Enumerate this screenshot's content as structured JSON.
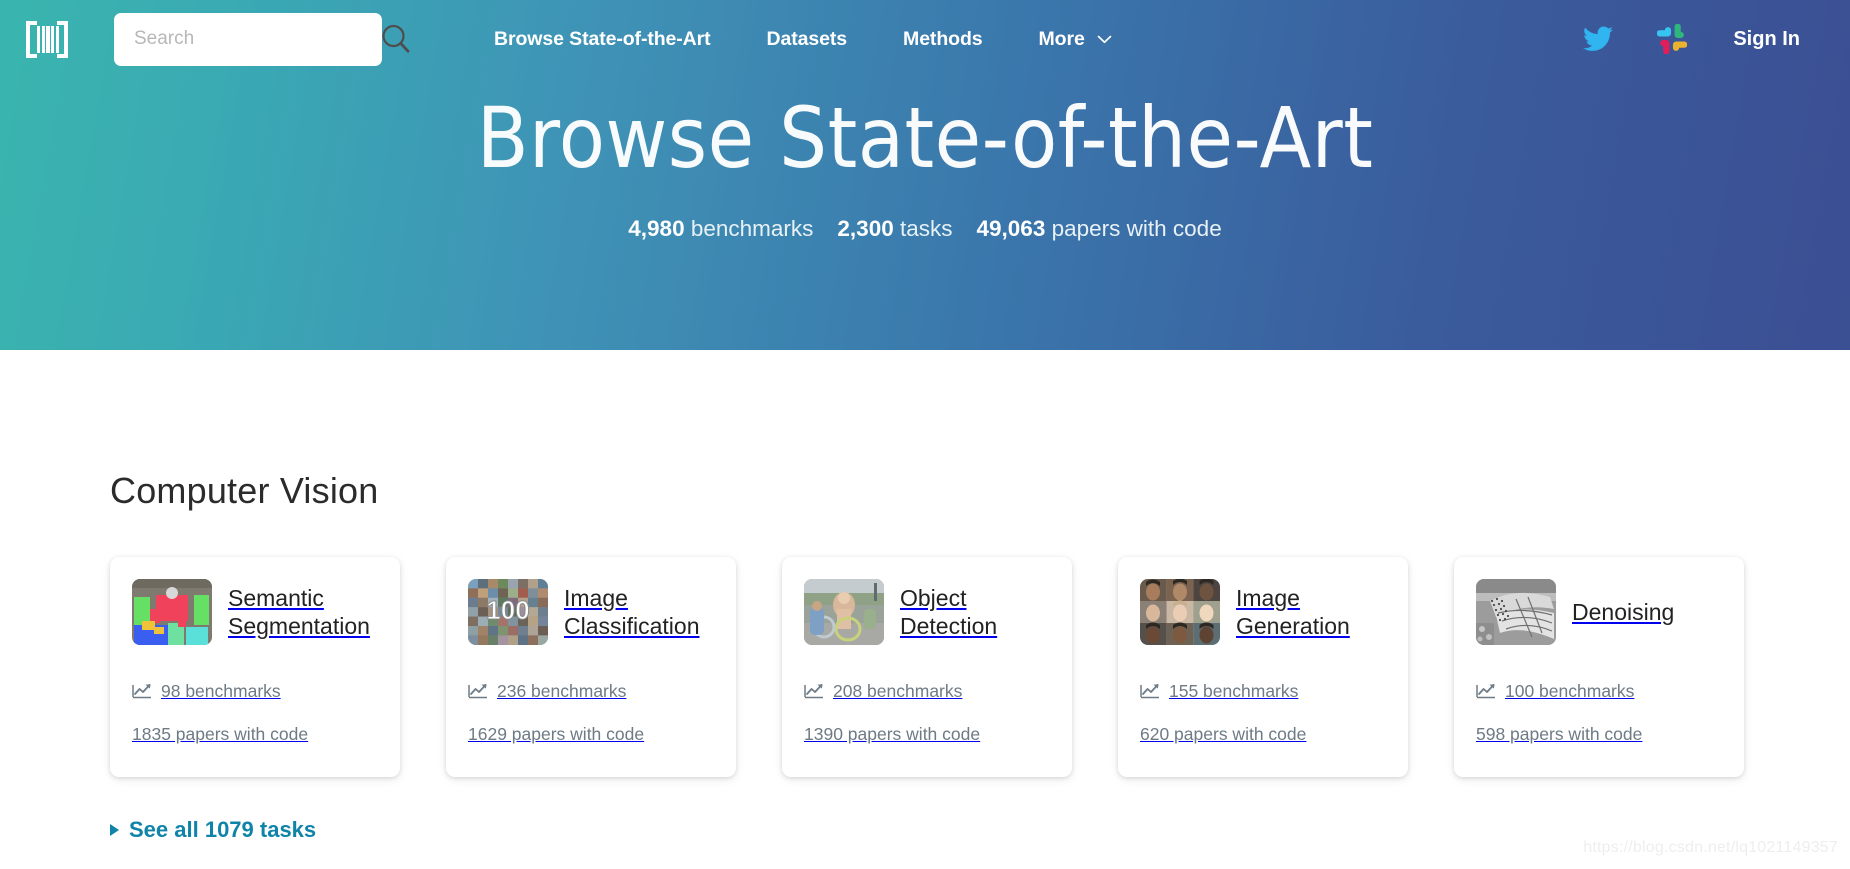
{
  "header": {
    "logo_alt": "Papers With Code",
    "search": {
      "value": "",
      "placeholder": "Search"
    },
    "nav": [
      {
        "label": "Browse State-of-the-Art",
        "has_caret": false
      },
      {
        "label": "Datasets",
        "has_caret": false
      },
      {
        "label": "Methods",
        "has_caret": false
      },
      {
        "label": "More",
        "has_caret": true
      }
    ],
    "twitter_icon": "twitter-icon",
    "slack_icon": "slack-icon",
    "sign_in_label": "Sign In",
    "gradient_from": "#3ab5ae",
    "gradient_to": "#3b4f93"
  },
  "hero": {
    "title": "Browse State-of-the-Art",
    "stats": [
      {
        "number": "4,980",
        "label": "benchmarks"
      },
      {
        "number": "2,300",
        "label": "tasks"
      },
      {
        "number": "49,063",
        "label": "papers with code"
      }
    ]
  },
  "main": {
    "section_title": "Computer Vision",
    "cards": [
      {
        "title": "Semantic Segmentation",
        "thumb": "semantic-segmentation-thumb",
        "benchmarks": "98 benchmarks",
        "papers": "1835 papers with code"
      },
      {
        "title": "Image Classification",
        "thumb": "image-classification-thumb",
        "benchmarks": "236 benchmarks",
        "papers": "1629 papers with code"
      },
      {
        "title": "Object Detection",
        "thumb": "object-detection-thumb",
        "benchmarks": "208 benchmarks",
        "papers": "1390 papers with code"
      },
      {
        "title": "Image Generation",
        "thumb": "image-generation-thumb",
        "benchmarks": "155 benchmarks",
        "papers": "620 papers with code"
      },
      {
        "title": "Denoising",
        "thumb": "denoising-thumb",
        "benchmarks": "100 benchmarks",
        "papers": "598 papers with code"
      }
    ],
    "see_all_label": "See all 1079 tasks",
    "link_color": "#0f83a8"
  },
  "watermark": "https://blog.csdn.net/lq1021149357"
}
